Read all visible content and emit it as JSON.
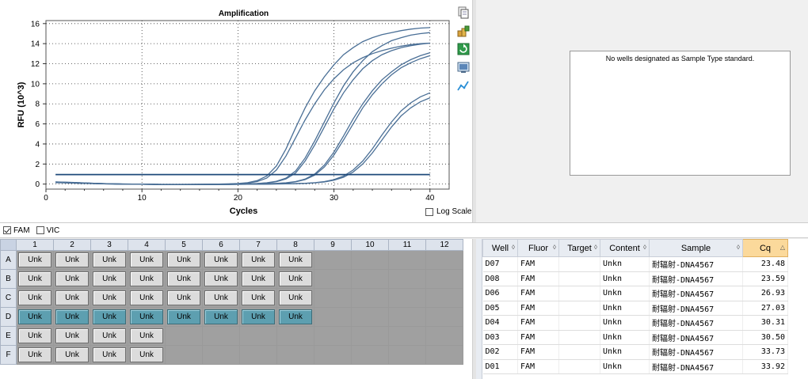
{
  "chart_data": {
    "type": "line",
    "title": "Amplification",
    "xlabel": "Cycles",
    "ylabel": "RFU (10^3)",
    "xlim": [
      0,
      42
    ],
    "ylim": [
      -0.5,
      16.3
    ],
    "xticks": [
      0,
      10,
      20,
      30,
      40
    ],
    "yticks": [
      0,
      2,
      4,
      6,
      8,
      10,
      12,
      14,
      16
    ],
    "grid": true,
    "threshold": 0.95,
    "x": [
      1,
      2,
      3,
      4,
      5,
      6,
      7,
      8,
      9,
      10,
      11,
      12,
      13,
      14,
      15,
      16,
      17,
      18,
      19,
      20,
      21,
      22,
      23,
      24,
      25,
      26,
      27,
      28,
      29,
      30,
      31,
      32,
      33,
      34,
      35,
      36,
      37,
      38,
      39,
      40
    ],
    "series": [
      {
        "values": [
          0.2,
          0.17,
          0.14,
          0.11,
          0.08,
          0.05,
          0.02,
          0.01,
          0,
          -0.01,
          -0.02,
          -0.03,
          -0.03,
          -0.03,
          -0.03,
          -0.02,
          -0.01,
          0,
          0.02,
          0.06,
          0.14,
          0.34,
          0.8,
          1.8,
          3.5,
          5.6,
          7.6,
          9.3,
          10.7,
          11.9,
          12.9,
          13.6,
          14.2,
          14.6,
          14.9,
          15.1,
          15.3,
          15.45,
          15.55,
          15.6
        ]
      },
      {
        "values": [
          0.18,
          0.15,
          0.12,
          0.09,
          0.06,
          0.03,
          0.01,
          0,
          -0.01,
          -0.02,
          -0.03,
          -0.04,
          -0.04,
          -0.04,
          -0.03,
          -0.02,
          -0.01,
          0,
          0.01,
          0.04,
          0.1,
          0.25,
          0.6,
          1.4,
          2.8,
          4.6,
          6.4,
          8.0,
          9.4,
          10.5,
          11.4,
          12.1,
          12.6,
          13.0,
          13.3,
          13.55,
          13.75,
          13.9,
          14.0,
          14.05
        ]
      },
      {
        "values": [
          0.19,
          0.16,
          0.13,
          0.1,
          0.07,
          0.04,
          0.02,
          0.01,
          0,
          -0.01,
          -0.02,
          -0.03,
          -0.03,
          -0.03,
          -0.03,
          -0.03,
          -0.02,
          -0.01,
          0,
          0.01,
          0.03,
          0.06,
          0.13,
          0.28,
          0.6,
          1.3,
          2.6,
          4.3,
          6.2,
          8.1,
          9.8,
          11.2,
          12.3,
          13.2,
          13.8,
          14.3,
          14.6,
          14.85,
          15.0,
          15.1
        ]
      },
      {
        "values": [
          0.17,
          0.14,
          0.11,
          0.08,
          0.05,
          0.03,
          0.01,
          0,
          -0.01,
          -0.02,
          -0.03,
          -0.04,
          -0.04,
          -0.04,
          -0.04,
          -0.03,
          -0.02,
          -0.01,
          0,
          0.01,
          0.02,
          0.05,
          0.11,
          0.24,
          0.52,
          1.1,
          2.3,
          3.9,
          5.7,
          7.5,
          9.1,
          10.4,
          11.5,
          12.3,
          12.9,
          13.3,
          13.6,
          13.8,
          13.95,
          14.05
        ]
      },
      {
        "values": [
          0.22,
          0.19,
          0.16,
          0.12,
          0.08,
          0.05,
          0.02,
          0,
          -0.01,
          -0.02,
          -0.03,
          -0.04,
          -0.05,
          -0.05,
          -0.05,
          -0.04,
          -0.04,
          -0.03,
          -0.02,
          -0.01,
          0,
          0.02,
          0.04,
          0.07,
          0.13,
          0.25,
          0.5,
          1.0,
          1.9,
          3.2,
          4.8,
          6.5,
          8.0,
          9.3,
          10.4,
          11.2,
          11.9,
          12.4,
          12.8,
          13.1
        ]
      },
      {
        "values": [
          0.21,
          0.18,
          0.15,
          0.11,
          0.07,
          0.04,
          0.02,
          0,
          -0.01,
          -0.02,
          -0.03,
          -0.04,
          -0.05,
          -0.05,
          -0.05,
          -0.04,
          -0.04,
          -0.03,
          -0.02,
          -0.01,
          0,
          0.01,
          0.03,
          0.06,
          0.11,
          0.22,
          0.45,
          0.9,
          1.7,
          2.9,
          4.4,
          6.0,
          7.6,
          8.9,
          10.0,
          10.9,
          11.6,
          12.1,
          12.5,
          12.8
        ]
      },
      {
        "values": [
          0.16,
          0.13,
          0.1,
          0.07,
          0.05,
          0.03,
          0.01,
          0,
          -0.01,
          -0.02,
          -0.03,
          -0.04,
          -0.05,
          -0.05,
          -0.05,
          -0.05,
          -0.05,
          -0.04,
          -0.04,
          -0.03,
          -0.02,
          -0.01,
          0,
          0.01,
          0.03,
          0.05,
          0.08,
          0.14,
          0.25,
          0.45,
          0.8,
          1.4,
          2.3,
          3.5,
          4.9,
          6.2,
          7.3,
          8.1,
          8.7,
          9.1
        ]
      },
      {
        "values": [
          0.15,
          0.12,
          0.09,
          0.07,
          0.05,
          0.03,
          0.01,
          0,
          -0.01,
          -0.02,
          -0.03,
          -0.04,
          -0.05,
          -0.05,
          -0.05,
          -0.05,
          -0.05,
          -0.04,
          -0.04,
          -0.03,
          -0.02,
          -0.01,
          0,
          0.01,
          0.02,
          0.04,
          0.07,
          0.12,
          0.21,
          0.38,
          0.68,
          1.2,
          2.0,
          3.1,
          4.4,
          5.7,
          6.8,
          7.6,
          8.2,
          8.6
        ]
      }
    ]
  },
  "chart": {
    "title": "Amplification",
    "xlabel": "Cycles",
    "ylabel": "RFU (10^3)",
    "log_scale_label": "Log Scale",
    "line_color": "#4a6f96",
    "threshold_color": "#1f4a7a",
    "toolbar_icons": [
      "copy-icon",
      "export-icon",
      "refresh-icon",
      "print-icon",
      "chart-settings-icon"
    ]
  },
  "std_curve": {
    "message": "No wells designated as Sample Type standard."
  },
  "fluors": [
    {
      "label": "FAM",
      "checked": true
    },
    {
      "label": "VIC",
      "checked": false
    }
  ],
  "plate": {
    "columns": [
      "1",
      "2",
      "3",
      "4",
      "5",
      "6",
      "7",
      "8",
      "9",
      "10",
      "11",
      "12"
    ],
    "rows": [
      {
        "label": "A",
        "wells": [
          "Unk",
          "Unk",
          "Unk",
          "Unk",
          "Unk",
          "Unk",
          "Unk",
          "Unk",
          "",
          "",
          "",
          ""
        ],
        "selected": false
      },
      {
        "label": "B",
        "wells": [
          "Unk",
          "Unk",
          "Unk",
          "Unk",
          "Unk",
          "Unk",
          "Unk",
          "Unk",
          "",
          "",
          "",
          ""
        ],
        "selected": false
      },
      {
        "label": "C",
        "wells": [
          "Unk",
          "Unk",
          "Unk",
          "Unk",
          "Unk",
          "Unk",
          "Unk",
          "Unk",
          "",
          "",
          "",
          ""
        ],
        "selected": false
      },
      {
        "label": "D",
        "wells": [
          "Unk",
          "Unk",
          "Unk",
          "Unk",
          "Unk",
          "Unk",
          "Unk",
          "Unk",
          "",
          "",
          "",
          ""
        ],
        "selected": true
      },
      {
        "label": "E",
        "wells": [
          "Unk",
          "Unk",
          "Unk",
          "Unk",
          "",
          "",
          "",
          "",
          "",
          "",
          "",
          ""
        ],
        "selected": false
      },
      {
        "label": "F",
        "wells": [
          "Unk",
          "Unk",
          "Unk",
          "Unk",
          "",
          "",
          "",
          "",
          "",
          "",
          "",
          ""
        ],
        "selected": false
      }
    ],
    "selected_color": "#5d9fb0"
  },
  "results": {
    "headers": [
      "Well",
      "Fluor",
      "Target",
      "Content",
      "Sample",
      "Cq"
    ],
    "sort_column": "Cq",
    "rows": [
      [
        "D07",
        "FAM",
        "",
        "Unkn",
        "耐辐射-DNA4567",
        "23.48"
      ],
      [
        "D08",
        "FAM",
        "",
        "Unkn",
        "耐辐射-DNA4567",
        "23.59"
      ],
      [
        "D06",
        "FAM",
        "",
        "Unkn",
        "耐辐射-DNA4567",
        "26.93"
      ],
      [
        "D05",
        "FAM",
        "",
        "Unkn",
        "耐辐射-DNA4567",
        "27.03"
      ],
      [
        "D04",
        "FAM",
        "",
        "Unkn",
        "耐辐射-DNA4567",
        "30.31"
      ],
      [
        "D03",
        "FAM",
        "",
        "Unkn",
        "耐辐射-DNA4567",
        "30.50"
      ],
      [
        "D02",
        "FAM",
        "",
        "Unkn",
        "耐辐射-DNA4567",
        "33.73"
      ],
      [
        "D01",
        "FAM",
        "",
        "Unkn",
        "耐辐射-DNA4567",
        "33.92"
      ]
    ]
  }
}
